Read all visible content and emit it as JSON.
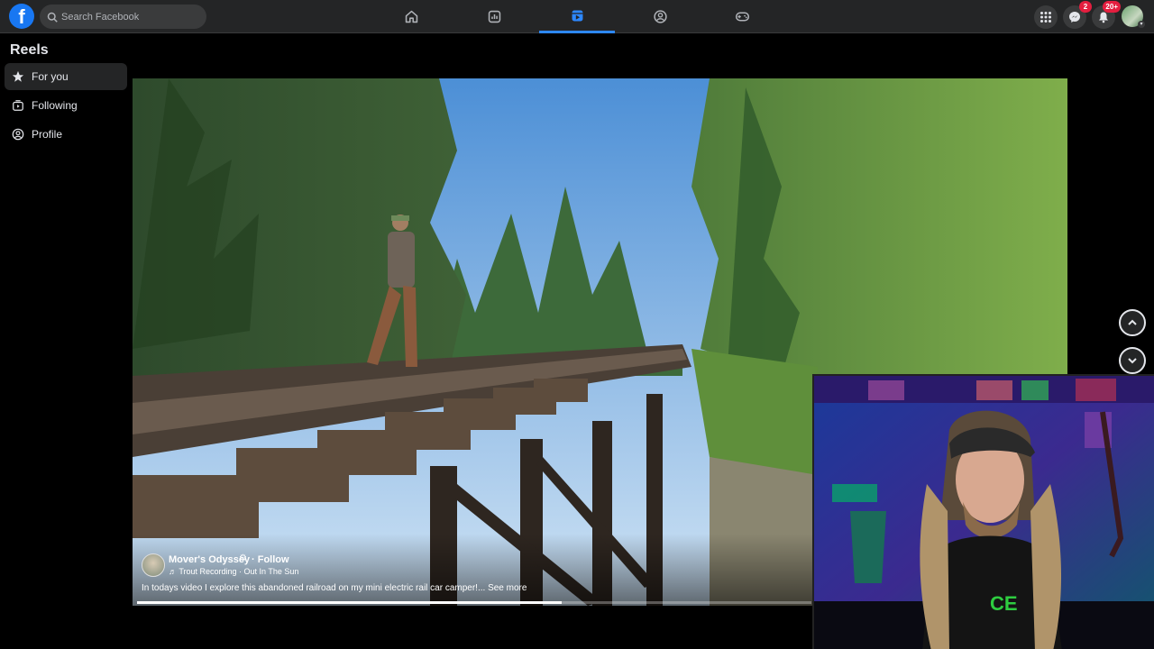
{
  "topbar": {
    "logo_letter": "f",
    "search_placeholder": "Search Facebook",
    "nav": [
      "home-icon",
      "dashboard-icon",
      "reels-icon",
      "groups-icon",
      "gaming-icon"
    ],
    "active_nav": "reels",
    "messenger_badge": "2",
    "notifications_badge": "20+"
  },
  "sidebar": {
    "title": "Reels",
    "items": [
      {
        "label": "For you",
        "icon": "star-icon",
        "active": true
      },
      {
        "label": "Following",
        "icon": "following-icon",
        "active": false
      },
      {
        "label": "Profile",
        "icon": "profile-icon",
        "active": false
      }
    ]
  },
  "reel": {
    "author": "Mover's Odyssey",
    "verified_mark": "⚙",
    "follow_label": "· Follow",
    "music": "♬ Trout Recording · Out In The Sun",
    "caption": "In todays video I explore this abandoned railroad on my mini electric rail car camper!...",
    "see_more": "See more",
    "progress_fraction": 0.63
  },
  "colors": {
    "accent": "#2d88ff",
    "brand": "#1877f2",
    "badge": "#e41e3f",
    "topbar_bg": "#242526"
  }
}
